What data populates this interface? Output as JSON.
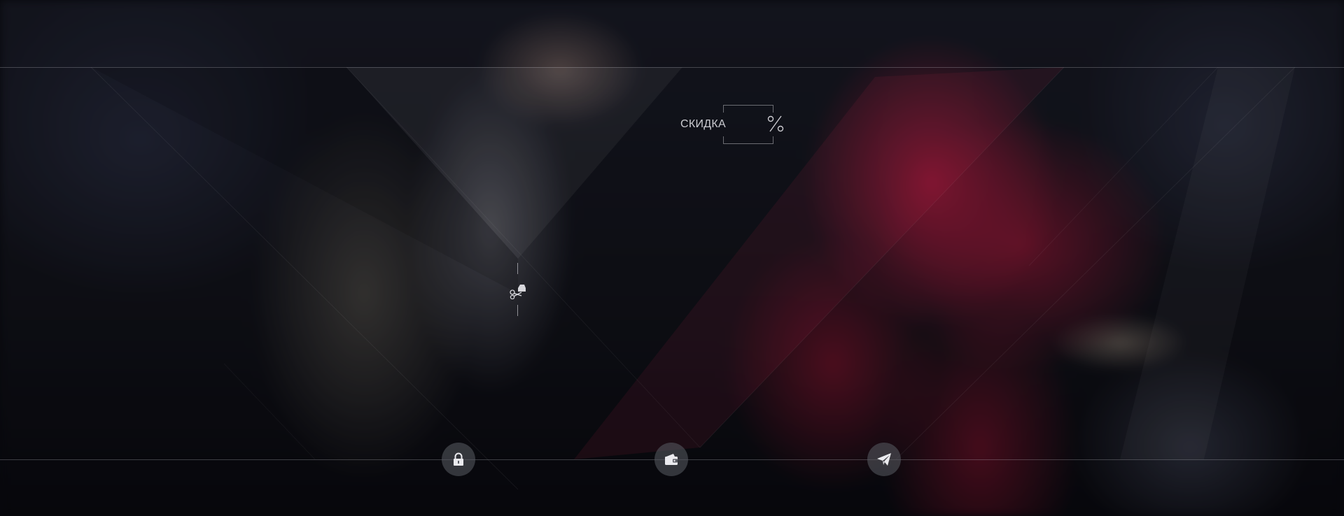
{
  "discount": {
    "label": "СКИДКА",
    "icon": "percent-icon"
  },
  "divider_icon": "scissors-icon",
  "footer_buttons": [
    {
      "name": "lock-button",
      "icon": "lock-icon"
    },
    {
      "name": "wallet-button",
      "icon": "wallet-icon"
    },
    {
      "name": "send-button",
      "icon": "paper-plane-icon"
    }
  ],
  "colors": {
    "accent_red": "#b8183f",
    "line": "#c8c8d2",
    "button_bg": "#5a5c64"
  }
}
